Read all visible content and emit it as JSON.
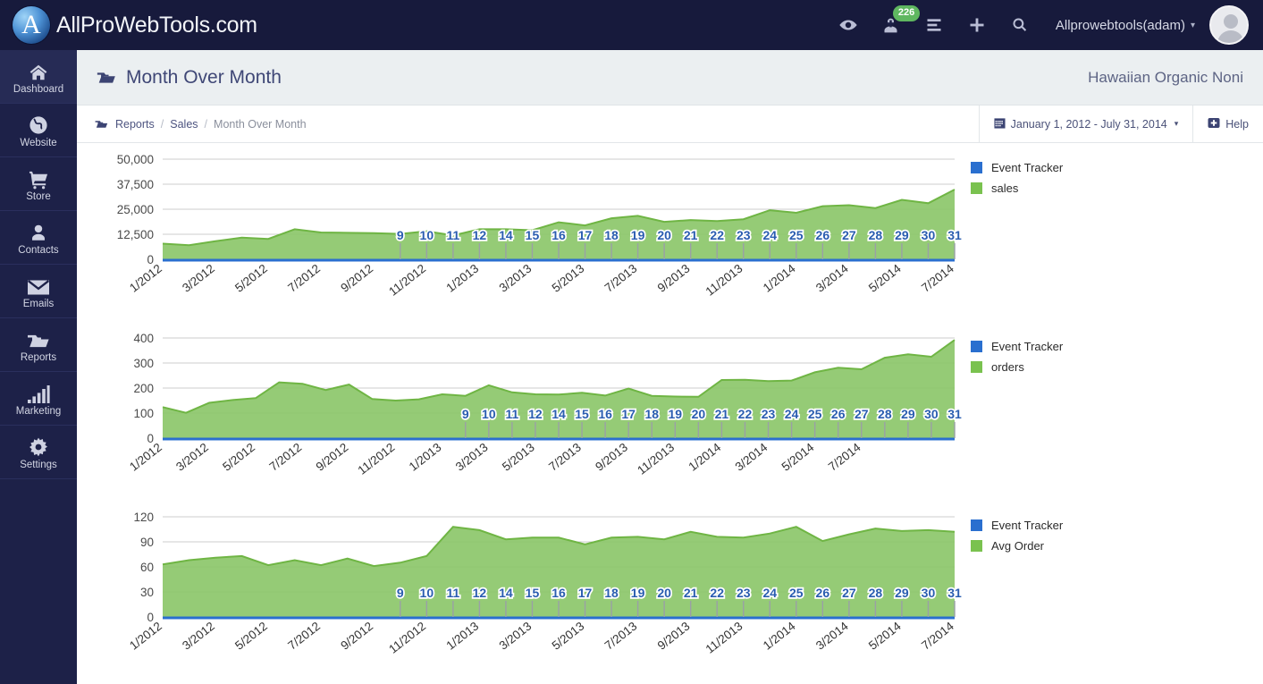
{
  "topbar": {
    "brand_name": "AllProWebTools.com",
    "brand_glyph": "A",
    "icons": [
      {
        "name": "eye-icon",
        "label": "eye-icon"
      },
      {
        "name": "visitor-tracker-icon",
        "label": "visitor-tracker-icon",
        "badge": "226"
      },
      {
        "name": "list-icon",
        "label": "list-icon"
      },
      {
        "name": "plus-icon",
        "label": "plus-icon"
      },
      {
        "name": "search-icon",
        "label": "search-icon"
      }
    ],
    "badge_count": "226",
    "username": "Allprowebtools(adam)",
    "caret": "▾"
  },
  "sidebar": {
    "items": [
      {
        "label": "Dashboard",
        "icon": "home-icon",
        "active": true
      },
      {
        "label": "Website",
        "icon": "globe-icon",
        "active": false
      },
      {
        "label": "Store",
        "icon": "shopping-cart-icon",
        "active": false
      },
      {
        "label": "Contacts",
        "icon": "person-icon",
        "active": false
      },
      {
        "label": "Emails",
        "icon": "envelope-icon",
        "active": false
      },
      {
        "label": "Reports",
        "icon": "folder-icon",
        "active": false
      },
      {
        "label": "Marketing",
        "icon": "bar-chart-icon",
        "active": false
      },
      {
        "label": "Settings",
        "icon": "gear-icon",
        "active": false
      }
    ]
  },
  "page": {
    "title": "Month Over Month",
    "title_icon": "folder-open-icon",
    "org_name": "Hawaiian Organic Noni"
  },
  "breadcrumb": {
    "icon": "folder-open-icon",
    "items": [
      "Reports",
      "Sales",
      "Month Over Month"
    ],
    "separator": "/"
  },
  "toolbar": {
    "date_range": "January 1, 2012 - July 31, 2014",
    "date_range_icon": "calendar-icon",
    "date_range_caret": "▾",
    "help_label": "Help",
    "help_icon": "help-badge-icon"
  },
  "colors": {
    "brand_navy": "#171a3c",
    "sidebar_navy": "#1d2148",
    "series_green": "#7ac24f",
    "series_green_fill": "#8cc76a",
    "series_blue": "#2a6fcf",
    "badge_green": "#5fb760",
    "grid": "#c9c9c9",
    "header_bg": "#ebeff1"
  },
  "chart_data": [
    {
      "type": "area",
      "title": "",
      "xlabel": "",
      "ylabel": "",
      "grid": true,
      "legend_position": "right",
      "legend": [
        "Event Tracker",
        "sales"
      ],
      "yticks": [
        0,
        12500,
        25000,
        37500,
        50000
      ],
      "ytick_labels": [
        "0",
        "12,500",
        "25,000",
        "37,500",
        "50,000"
      ],
      "ylim": [
        0,
        50000
      ],
      "x": [
        "1/2012",
        "2/2012",
        "3/2012",
        "4/2012",
        "5/2012",
        "6/2012",
        "7/2012",
        "8/2012",
        "9/2012",
        "10/2012",
        "11/2012",
        "12/2012",
        "1/2013",
        "2/2013",
        "3/2013",
        "4/2013",
        "5/2013",
        "6/2013",
        "7/2013",
        "8/2013",
        "9/2013",
        "10/2013",
        "11/2013",
        "12/2013",
        "1/2014",
        "2/2014",
        "3/2014",
        "4/2014",
        "5/2014",
        "6/2014",
        "7/2014"
      ],
      "xtick_labels": [
        "1/2012",
        "3/2012",
        "5/2012",
        "7/2012",
        "9/2012",
        "11/2012",
        "1/2013",
        "3/2013",
        "5/2013",
        "7/2013",
        "9/2013",
        "11/2013",
        "1/2014",
        "3/2014",
        "5/2014",
        "7/2014"
      ],
      "series": [
        {
          "name": "sales",
          "color": "#7ac24f",
          "values": [
            7800,
            7000,
            9000,
            10800,
            10200,
            15000,
            13400,
            13200,
            13100,
            12700,
            14000,
            11900,
            15000,
            15000,
            14500,
            18500,
            16900,
            20500,
            21700,
            18700,
            19600,
            19100,
            20000,
            24500,
            23200,
            26500,
            27000,
            25600,
            29700,
            28000,
            34800
          ]
        },
        {
          "name": "Event Tracker",
          "color": "#2a6fcf",
          "values": [
            0,
            0,
            0,
            0,
            0,
            0,
            0,
            0,
            0,
            0,
            0,
            0,
            0,
            0,
            0,
            0,
            0,
            0,
            0,
            0,
            0,
            0,
            0,
            0,
            0,
            0,
            0,
            0,
            0,
            0,
            0
          ]
        }
      ],
      "event_markers": [
        "9",
        "10",
        "11",
        "12",
        "14",
        "15",
        "16",
        "17",
        "18",
        "19",
        "20",
        "21",
        "22",
        "23",
        "24",
        "25",
        "26",
        "27",
        "28",
        "29",
        "30",
        "31"
      ]
    },
    {
      "type": "area",
      "title": "",
      "xlabel": "",
      "ylabel": "",
      "grid": true,
      "legend_position": "right",
      "legend": [
        "Event Tracker",
        "orders"
      ],
      "yticks": [
        0,
        100,
        200,
        300,
        400
      ],
      "ytick_labels": [
        "0",
        "100",
        "200",
        "300",
        "400"
      ],
      "ylim": [
        0,
        400
      ],
      "x": [
        "1/2012",
        "2/2012",
        "3/2012",
        "4/2012",
        "5/2012",
        "6/2012",
        "7/2012",
        "8/2012",
        "9/2012",
        "10/2012",
        "11/2012",
        "12/2012",
        "1/2013",
        "2/2013",
        "3/2013",
        "4/2013",
        "5/2013",
        "6/2013",
        "7/2013",
        "8/2013",
        "9/2013",
        "10/2013",
        "11/2013",
        "12/2013",
        "1/2014",
        "2/2014",
        "3/2014",
        "4/2014",
        "5/2014",
        "6/2014",
        "7/2014"
      ],
      "xtick_labels": [
        "1/2012",
        "3/2012",
        "5/2012",
        "7/2012",
        "9/2012",
        "11/2012",
        "1/2013",
        "3/2013",
        "5/2013",
        "7/2013",
        "9/2013",
        "11/2013",
        "1/2014",
        "3/2014",
        "5/2014",
        "7/2014"
      ],
      "series": [
        {
          "name": "orders",
          "color": "#7ac24f",
          "values": [
            124,
            101,
            141,
            152,
            160,
            223,
            217,
            192,
            214,
            156,
            150,
            155,
            175,
            169,
            211,
            183,
            175,
            174,
            181,
            170,
            198,
            169,
            166,
            165,
            232,
            233,
            228,
            230,
            263,
            281,
            275,
            321,
            335,
            325,
            392
          ]
        },
        {
          "name": "Event Tracker",
          "color": "#2a6fcf",
          "values": [
            0,
            0,
            0,
            0,
            0,
            0,
            0,
            0,
            0,
            0,
            0,
            0,
            0,
            0,
            0,
            0,
            0,
            0,
            0,
            0,
            0,
            0,
            0,
            0,
            0,
            0,
            0,
            0,
            0,
            0,
            0
          ]
        }
      ],
      "event_markers": [
        "9",
        "10",
        "11",
        "12",
        "14",
        "15",
        "16",
        "17",
        "18",
        "19",
        "20",
        "21",
        "22",
        "23",
        "24",
        "25",
        "26",
        "27",
        "28",
        "29",
        "30",
        "31"
      ]
    },
    {
      "type": "area",
      "title": "",
      "xlabel": "",
      "ylabel": "",
      "grid": true,
      "legend_position": "right",
      "legend": [
        "Event Tracker",
        "Avg Order"
      ],
      "yticks": [
        0,
        30,
        60,
        90,
        120
      ],
      "ytick_labels": [
        "0",
        "30",
        "60",
        "90",
        "120"
      ],
      "ylim": [
        0,
        120
      ],
      "x": [
        "1/2012",
        "2/2012",
        "3/2012",
        "4/2012",
        "5/2012",
        "6/2012",
        "7/2012",
        "8/2012",
        "9/2012",
        "10/2012",
        "11/2012",
        "12/2012",
        "1/2013",
        "2/2013",
        "3/2013",
        "4/2013",
        "5/2013",
        "6/2013",
        "7/2013",
        "8/2013",
        "9/2013",
        "10/2013",
        "11/2013",
        "12/2013",
        "1/2014",
        "2/2014",
        "3/2014",
        "4/2014",
        "5/2014",
        "6/2014",
        "7/2014"
      ],
      "xtick_labels": [
        "1/2012",
        "3/2012",
        "5/2012",
        "7/2012",
        "9/2012",
        "11/2012",
        "1/2013",
        "3/2013",
        "5/2013",
        "7/2013",
        "9/2013",
        "11/2013",
        "1/2014",
        "3/2014",
        "5/2014",
        "7/2014"
      ],
      "series": [
        {
          "name": "Avg Order",
          "color": "#7ac24f",
          "values": [
            63,
            68,
            71,
            73,
            62,
            68,
            62,
            70,
            61,
            65,
            73,
            108,
            104,
            93,
            95,
            95,
            87,
            95,
            96,
            93,
            102,
            96,
            95,
            100,
            108,
            91,
            99,
            106,
            103,
            104,
            102
          ]
        },
        {
          "name": "Event Tracker",
          "color": "#2a6fcf",
          "values": [
            0,
            0,
            0,
            0,
            0,
            0,
            0,
            0,
            0,
            0,
            0,
            0,
            0,
            0,
            0,
            0,
            0,
            0,
            0,
            0,
            0,
            0,
            0,
            0,
            0,
            0,
            0,
            0,
            0,
            0,
            0
          ]
        }
      ],
      "event_markers": [
        "9",
        "10",
        "11",
        "12",
        "14",
        "15",
        "16",
        "17",
        "18",
        "19",
        "20",
        "21",
        "22",
        "23",
        "24",
        "25",
        "26",
        "27",
        "28",
        "29",
        "30",
        "31"
      ]
    }
  ]
}
